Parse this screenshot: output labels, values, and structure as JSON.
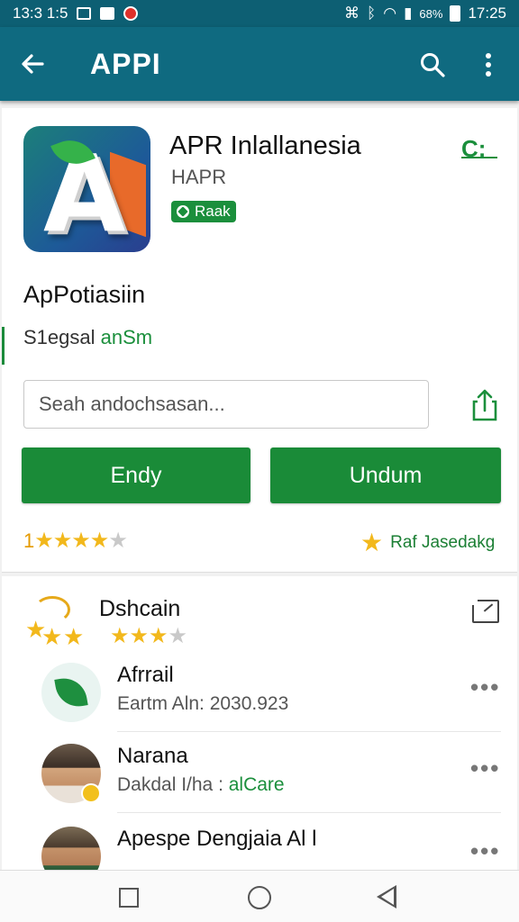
{
  "status_bar": {
    "left_text": "13:3 1:5",
    "right_text": "17:25",
    "battery_text": "68%"
  },
  "app_bar": {
    "title": "APPI",
    "back_icon": "arrow-left-icon",
    "search_icon": "search-icon",
    "more_icon": "more-vert-icon"
  },
  "app": {
    "name": "APR Inlallanesia",
    "developer": "HAPR",
    "badge_label": "Raak",
    "corner_icon_label": "C:"
  },
  "section": {
    "title": "ApPotiasiin",
    "sub_prefix": "S1egsal",
    "sub_green": "anSm"
  },
  "search": {
    "placeholder": "Seah andochsasan..."
  },
  "buttons": {
    "left_label": "Endy",
    "right_label": "Undum"
  },
  "rating": {
    "value_text": "1",
    "stars_filled": 4,
    "stars_total": 5,
    "link_label": "Raf Jasedakg"
  },
  "reviews": {
    "title": "Dshcain",
    "stars_filled": 3,
    "stars_total": 4,
    "items": [
      {
        "name": "Afrrail",
        "meta": "Eartm Aln: 2030.923",
        "meta_green": ""
      },
      {
        "name": "Narana",
        "meta": "Dakdal I/ha : ",
        "meta_green": "alCare"
      },
      {
        "name": "Apespe Dengjaia Al l",
        "meta": "",
        "meta_green": ""
      }
    ],
    "more_label": "•••"
  },
  "colors": {
    "primary": "#0f6a80",
    "accent_green": "#1a8b38",
    "star": "#f2b81c"
  }
}
